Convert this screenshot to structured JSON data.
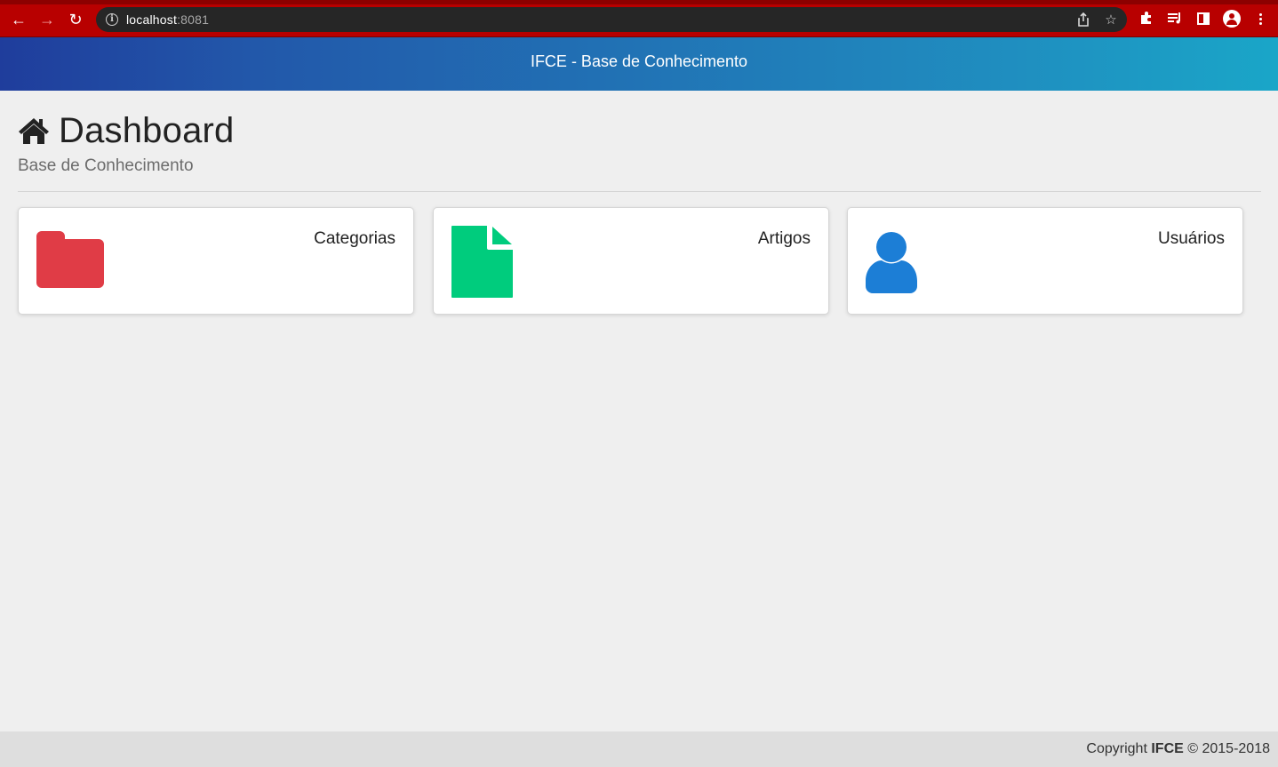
{
  "browser": {
    "url_host": "localhost",
    "url_port": ":8081",
    "icons": [
      "back-icon",
      "forward-icon",
      "reload-icon",
      "info-icon",
      "share-icon",
      "star-icon",
      "extensions-icon",
      "media-icon",
      "side-panel-icon",
      "profile-icon",
      "menu-icon"
    ]
  },
  "header": {
    "title": "IFCE - Base de Conhecimento"
  },
  "page": {
    "title": "Dashboard",
    "subtitle": "Base de Conhecimento",
    "icon": "home-icon"
  },
  "cards": [
    {
      "label": "Categorias",
      "icon": "folder-icon",
      "color": "#e03c46"
    },
    {
      "label": "Artigos",
      "icon": "file-icon",
      "color": "#00cc7d"
    },
    {
      "label": "Usuários",
      "icon": "user-icon",
      "color": "#1c7ed6"
    }
  ],
  "footer": {
    "prefix": "Copyright ",
    "brand": "IFCE",
    "suffix": " © 2015-2018"
  },
  "colors": {
    "browser_chrome": "#b80000",
    "background": "#efefef",
    "header_gradient_start": "#1f3d9c",
    "header_gradient_end": "#1aa6c8"
  }
}
